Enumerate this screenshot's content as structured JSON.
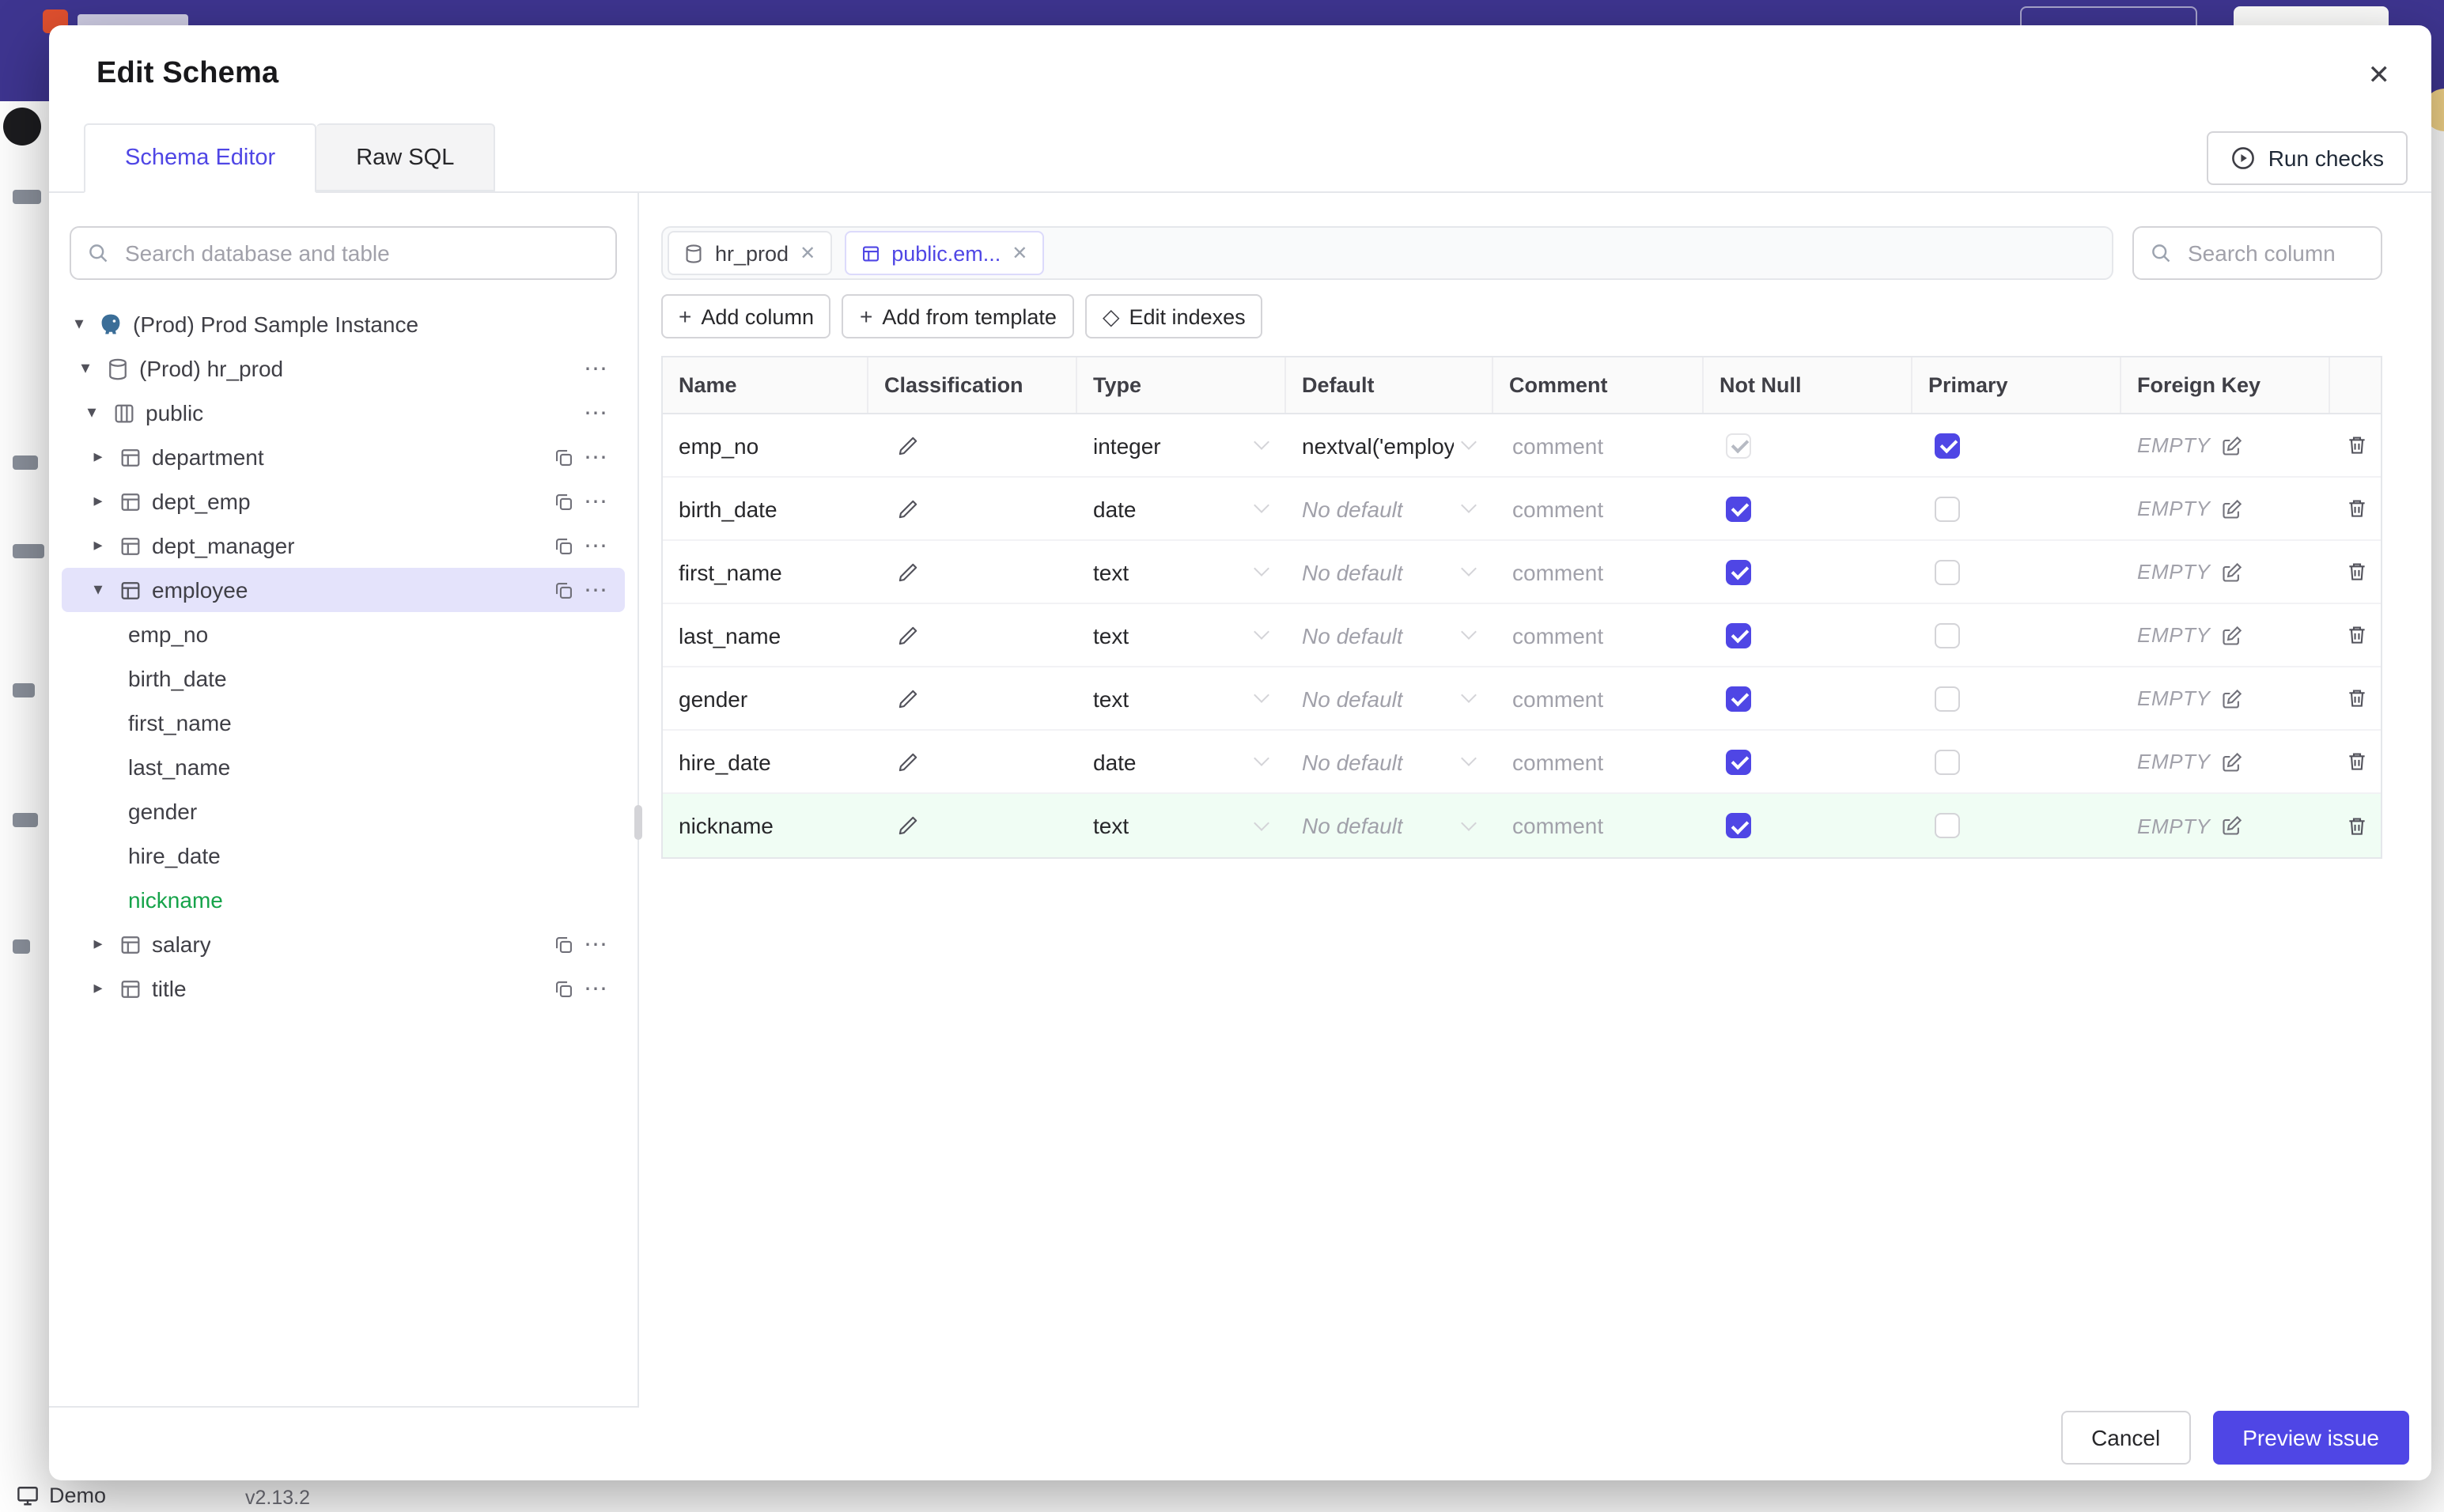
{
  "icons": {
    "close": "✕",
    "caret_down": "▾",
    "caret_right": "▸",
    "kebab": "⋯",
    "plus": "+",
    "diamond": "◇"
  },
  "backdrop": {
    "demo_label": "Demo",
    "version": "v2.13.2"
  },
  "modal": {
    "title": "Edit Schema",
    "tabs": [
      {
        "label": "Schema Editor"
      },
      {
        "label": "Raw SQL"
      }
    ],
    "run_checks_label": "Run checks"
  },
  "sidebar": {
    "search_placeholder": "Search database and table",
    "tree": [
      {
        "label": "(Prod) Prod Sample Instance",
        "cls": ""
      },
      {
        "label": "(Prod) hr_prod",
        "cls": ""
      },
      {
        "label": "public",
        "cls": ""
      },
      {
        "label": "department",
        "cls": ""
      },
      {
        "label": "dept_emp",
        "cls": ""
      },
      {
        "label": "dept_manager",
        "cls": ""
      },
      {
        "label": "employee",
        "cls": "selected"
      },
      {
        "label": "emp_no",
        "cls": ""
      },
      {
        "label": "birth_date",
        "cls": ""
      },
      {
        "label": "first_name",
        "cls": ""
      },
      {
        "label": "last_name",
        "cls": ""
      },
      {
        "label": "gender",
        "cls": ""
      },
      {
        "label": "hire_date",
        "cls": ""
      },
      {
        "label": "nickname",
        "cls": "green"
      },
      {
        "label": "salary",
        "cls": ""
      },
      {
        "label": "title",
        "cls": ""
      }
    ]
  },
  "main": {
    "chips": [
      {
        "label": "hr_prod",
        "cls": ""
      },
      {
        "label": "public.em...",
        "cls": "active"
      }
    ],
    "column_search_placeholder": "Search column",
    "toolbar": {
      "add_column": "Add column",
      "add_from_template": "Add from template",
      "edit_indexes": "Edit indexes"
    },
    "table": {
      "headers": [
        "Name",
        "Classification",
        "Type",
        "Default",
        "Comment",
        "Not Null",
        "Primary",
        "Foreign Key"
      ],
      "rows": [
        {
          "name": "emp_no",
          "type": "integer",
          "default": "nextval('employ",
          "default_cls": "value",
          "comment_placeholder": "comment",
          "not_null_cls": "checked muted",
          "primary_cls": "checked",
          "foreign_key": "EMPTY",
          "row_cls": ""
        },
        {
          "name": "birth_date",
          "type": "date",
          "default": "No default",
          "default_cls": "placeholder",
          "comment_placeholder": "comment",
          "not_null_cls": "checked",
          "primary_cls": "",
          "foreign_key": "EMPTY",
          "row_cls": ""
        },
        {
          "name": "first_name",
          "type": "text",
          "default": "No default",
          "default_cls": "placeholder",
          "comment_placeholder": "comment",
          "not_null_cls": "checked",
          "primary_cls": "",
          "foreign_key": "EMPTY",
          "row_cls": ""
        },
        {
          "name": "last_name",
          "type": "text",
          "default": "No default",
          "default_cls": "placeholder",
          "comment_placeholder": "comment",
          "not_null_cls": "checked",
          "primary_cls": "",
          "foreign_key": "EMPTY",
          "row_cls": ""
        },
        {
          "name": "gender",
          "type": "text",
          "default": "No default",
          "default_cls": "placeholder",
          "comment_placeholder": "comment",
          "not_null_cls": "checked",
          "primary_cls": "",
          "foreign_key": "EMPTY",
          "row_cls": ""
        },
        {
          "name": "hire_date",
          "type": "date",
          "default": "No default",
          "default_cls": "placeholder",
          "comment_placeholder": "comment",
          "not_null_cls": "checked",
          "primary_cls": "",
          "foreign_key": "EMPTY",
          "row_cls": ""
        },
        {
          "name": "nickname",
          "type": "text",
          "default": "No default",
          "default_cls": "placeholder",
          "comment_placeholder": "comment",
          "not_null_cls": "checked",
          "primary_cls": "",
          "foreign_key": "EMPTY",
          "row_cls": "added"
        }
      ]
    }
  },
  "footer": {
    "cancel_label": "Cancel",
    "preview_label": "Preview issue"
  }
}
